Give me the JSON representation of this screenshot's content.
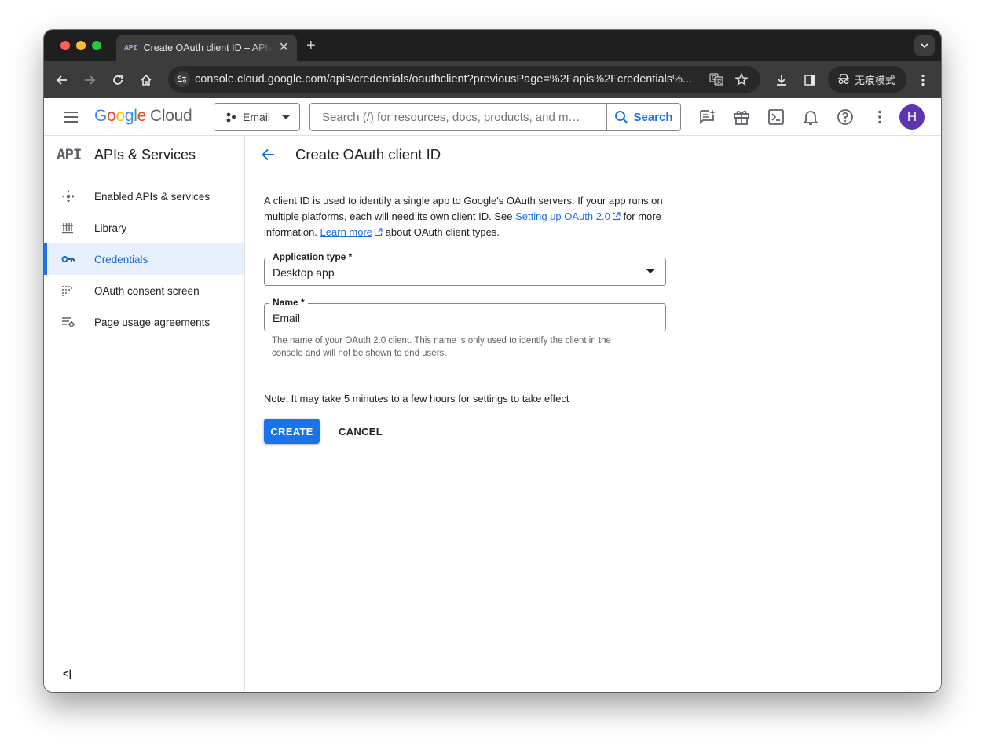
{
  "browser": {
    "tab_favicon": "API",
    "tab_title": "Create OAuth client ID – APIs & Services",
    "url": "console.cloud.google.com/apis/credentials/oauthclient?previousPage=%2Fapis%2Fcredentials%...",
    "incognito_label": "无痕模式"
  },
  "header": {
    "logo_text": "Google",
    "logo_suffix": "Cloud",
    "project_label": "Email",
    "search_placeholder": "Search (/) for resources, docs, products, and m…",
    "search_button": "Search",
    "avatar_initial": "H"
  },
  "sidebar": {
    "section_icon": "API",
    "title": "APIs & Services",
    "items": [
      {
        "label": "Enabled APIs & services",
        "icon": "diamond-arrows-icon"
      },
      {
        "label": "Library",
        "icon": "library-icon"
      },
      {
        "label": "Credentials",
        "icon": "key-icon",
        "active": true
      },
      {
        "label": "OAuth consent screen",
        "icon": "consent-dots-icon"
      },
      {
        "label": "Page usage agreements",
        "icon": "settings-list-icon"
      }
    ],
    "collapse_label": "<|"
  },
  "main": {
    "title": "Create OAuth client ID",
    "description_1": "A client ID is used to identify a single app to Google's OAuth servers. If your app runs on multiple platforms, each will need its own client ID. See",
    "link_1": "Setting up OAuth 2.0",
    "description_2": "for more information.",
    "link_2": "Learn more",
    "description_3": "about OAuth client types.",
    "app_type_label": "Application type *",
    "app_type_value": "Desktop app",
    "name_label": "Name *",
    "name_value": "Email",
    "name_hint": "The name of your OAuth 2.0 client. This name is only used to identify the client in the console and will not be shown to end users.",
    "note": "Note: It may take 5 minutes to a few hours for settings to take effect",
    "create_button": "CREATE",
    "cancel_button": "CANCEL"
  },
  "colors": {
    "accent": "#1a73e8",
    "avatar": "#5e35b1",
    "active_bg": "#e8f0fe"
  }
}
